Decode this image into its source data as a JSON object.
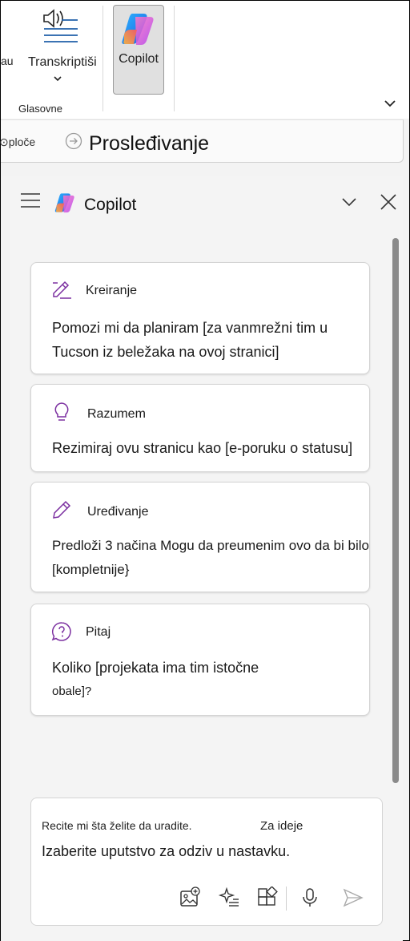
{
  "ribbon": {
    "partial_label": "au",
    "transcribe_label": "Transkriptiši",
    "copilot_label": "Copilot",
    "group_label": "Glasovne"
  },
  "breadcrumb": {
    "left_text": "ploče",
    "title": "Prosleđivanje"
  },
  "pane": {
    "title": "Copilot"
  },
  "prompts": [
    {
      "category": "Kreiranje",
      "icon": "pen-sparkle-icon",
      "lines": [
        "Pomozi mi da planiram [za vanmrežni tim u",
        "Tucson iz beležaka na ovoj stranici]"
      ]
    },
    {
      "category": "Razumem",
      "icon": "lightbulb-icon",
      "lines": [
        "Rezimiraj ovu stranicu kao [e-poruku o statusu]"
      ]
    },
    {
      "category": "Uređivanje",
      "icon": "pencil-icon",
      "lines": [
        "Predloži 3 načina  Mogu da preumenim ovo da bi bilo",
        "[kompletnije}"
      ]
    },
    {
      "category": "Pitaj",
      "icon": "question-bubble-icon",
      "lines": [
        "Koliko [projekata ima tim istočne",
        "obale]?"
      ]
    }
  ],
  "input": {
    "hint": "Recite mi šta želite da uradite.",
    "ideas": "Za ideje",
    "main": "Izaberite uputstvo za odziv u nastavku."
  },
  "colors": {
    "accent_purple": "#7b2fa0",
    "pane_background": "#f4f4f4"
  }
}
